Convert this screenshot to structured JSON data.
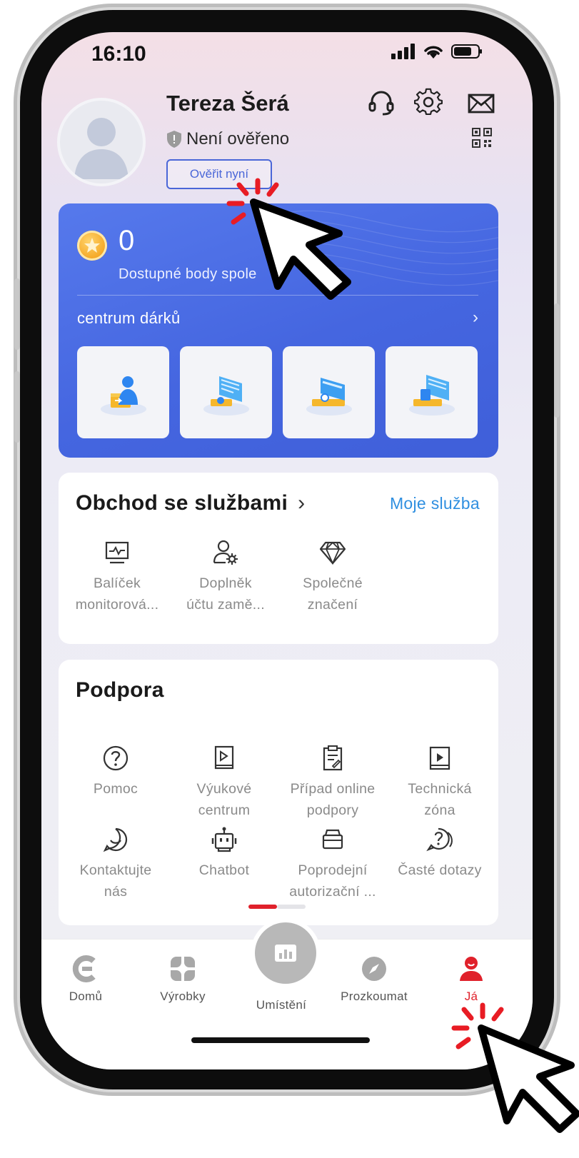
{
  "status_bar": {
    "time": "16:10"
  },
  "profile": {
    "name": "Tereza Šerá",
    "verification_status": "Není ověřeno",
    "verify_button": "Ověřit nyní"
  },
  "points_card": {
    "points": "0",
    "points_label": "Dostupné body spole",
    "gift_center": "centrum dárků",
    "gift_chevron": "›"
  },
  "services": {
    "title": "Obchod se službami",
    "title_chevron": "›",
    "link": "Moje služba",
    "items": [
      {
        "line1": "Balíček",
        "line2": "monitorová...",
        "icon": "monitor-icon"
      },
      {
        "line1": "Doplněk",
        "line2": "účtu zamě...",
        "icon": "user-settings-icon"
      },
      {
        "line1": "Společné",
        "line2": "značení",
        "icon": "diamond-icon"
      }
    ]
  },
  "support": {
    "title": "Podpora",
    "items": [
      {
        "line1": "Pomoc",
        "line2": "",
        "icon": "help-icon"
      },
      {
        "line1": "Výukové",
        "line2": "centrum",
        "icon": "book-icon"
      },
      {
        "line1": "Případ online",
        "line2": "podpory",
        "icon": "clipboard-icon"
      },
      {
        "line1": "Technická",
        "line2": "zóna",
        "icon": "video-icon"
      },
      {
        "line1": "Kontaktujte",
        "line2": "nás",
        "icon": "chat-icon"
      },
      {
        "line1": "Chatbot",
        "line2": "",
        "icon": "robot-icon"
      },
      {
        "line1": "Poprodejní",
        "line2": "autorizační ...",
        "icon": "box-icon"
      },
      {
        "line1": "Časté dotazy",
        "line2": "",
        "icon": "faq-icon"
      }
    ]
  },
  "tabbar": {
    "tabs": [
      {
        "label": "Domů",
        "icon": "home-logo-icon",
        "active": false
      },
      {
        "label": "Výrobky",
        "icon": "grid-icon",
        "active": false
      },
      {
        "label": "Umístění",
        "icon": "location-chart-icon",
        "active": false
      },
      {
        "label": "Prozkoumat",
        "icon": "compass-icon",
        "active": false
      },
      {
        "label": "Já",
        "icon": "person-icon",
        "active": true
      }
    ]
  },
  "colors": {
    "accent_blue": "#4566e0",
    "link_blue": "#2f8fe0",
    "active_red": "#e0212b"
  }
}
